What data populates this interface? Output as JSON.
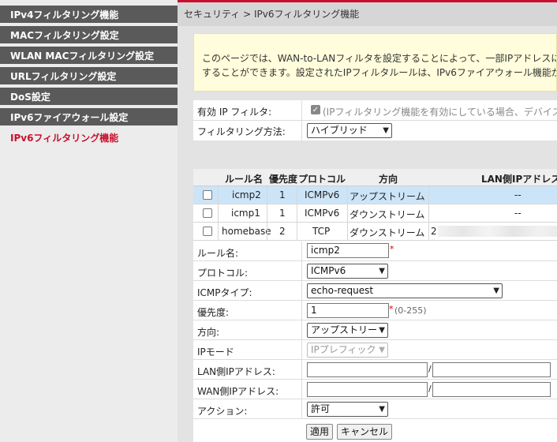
{
  "sidebar": {
    "items": [
      {
        "label": "IPv4フィルタリング機能",
        "active": false
      },
      {
        "label": "MACフィルタリング設定",
        "active": false
      },
      {
        "label": "WLAN MACフィルタリング設定",
        "active": false
      },
      {
        "label": "URLフィルタリング設定",
        "active": false
      },
      {
        "label": "DoS設定",
        "active": false
      },
      {
        "label": "IPv6ファイアウォール設定",
        "active": false
      },
      {
        "label": "IPv6フィルタリング機能",
        "active": true
      }
    ]
  },
  "header": {
    "breadcrumb": "セキュリティ > IPv6フィルタリング機能"
  },
  "info": {
    "line1": "このページでは、WAN-to-LANフィルタを設定することによって、一部IPアドレスに",
    "line2": "することができます。設定されたIPフィルタルールは、IPv6ファイアウォール機能が"
  },
  "filter_settings": {
    "enable_label": "有効 IP フィルタ:",
    "enable_checked": true,
    "enable_note": "(IPフィルタリング機能を有効にしている場合、デバイス",
    "method_label": "フィルタリング方法:",
    "method_value": "ハイブリッド"
  },
  "rules_table": {
    "columns": [
      "ルール名",
      "優先度",
      "プロトコル",
      "方向",
      "LAN側IPアドレス"
    ],
    "rows": [
      {
        "name": "icmp2",
        "priority": "1",
        "protocol": "ICMPv6",
        "direction": "アップストリーム",
        "lan_ip": "--",
        "selected": true
      },
      {
        "name": "icmp1",
        "priority": "1",
        "protocol": "ICMPv6",
        "direction": "ダウンストリーム",
        "lan_ip": "--",
        "selected": false
      },
      {
        "name": "homebase",
        "priority": "2",
        "protocol": "TCP",
        "direction": "ダウンストリーム",
        "lan_ip": "2",
        "selected": false
      }
    ]
  },
  "rule_form": {
    "rule_name_label": "ルール名:",
    "rule_name_value": "icmp2",
    "protocol_label": "プロトコル:",
    "protocol_value": "ICMPv6",
    "icmp_type_label": "ICMPタイプ:",
    "icmp_type_value": "echo-request",
    "priority_label": "優先度:",
    "priority_value": "1",
    "priority_hint": "(0-255)",
    "direction_label": "方向:",
    "direction_value": "アップストリー",
    "ip_mode_label": "IPモード",
    "ip_mode_value": "IPプレフィック",
    "lan_ip_label": "LAN側IPアドレス:",
    "wan_ip_label": "WAN側IPアドレス:",
    "action_label": "アクション:",
    "action_value": "許可",
    "required_mark": "*",
    "slash": "/"
  },
  "buttons": {
    "apply": "適用",
    "cancel": "キャンセル"
  },
  "colors": {
    "accent": "#c8102e",
    "nav_bg": "#5a5a5a",
    "selected_row": "#cce4f7",
    "info_bg": "#fffddc"
  }
}
